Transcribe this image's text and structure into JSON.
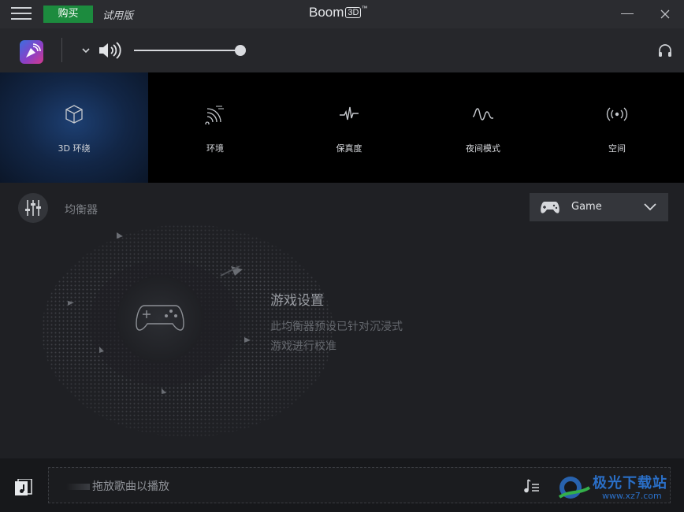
{
  "titlebar": {
    "buy_label": "购买",
    "trial_label": "试用版",
    "app_name": "Boom",
    "app_badge": "3D",
    "trademark": "™"
  },
  "volume": {
    "level_percent": 100
  },
  "effects": [
    {
      "label": "3D 环绕",
      "icon": "cube-icon",
      "active": true
    },
    {
      "label": "环境",
      "icon": "ambience-icon",
      "active": false
    },
    {
      "label": "保真度",
      "icon": "fidelity-icon",
      "active": false
    },
    {
      "label": "夜间模式",
      "icon": "night-mode-icon",
      "active": false
    },
    {
      "label": "空间",
      "icon": "spatial-icon",
      "active": false
    }
  ],
  "equalizer": {
    "label": "均衡器",
    "preset": "Game",
    "preset_title": "游戏设置",
    "preset_description": "此均衡器预设已针对沉浸式游戏进行校准"
  },
  "player": {
    "drop_text": "拖放歌曲以播放"
  },
  "watermark": {
    "text": "极光下载站",
    "url": "www.xz7.com"
  },
  "colors": {
    "buy_button": "#1c8b3e",
    "active_tab": "#1d3f72",
    "background": "#1f2024"
  }
}
